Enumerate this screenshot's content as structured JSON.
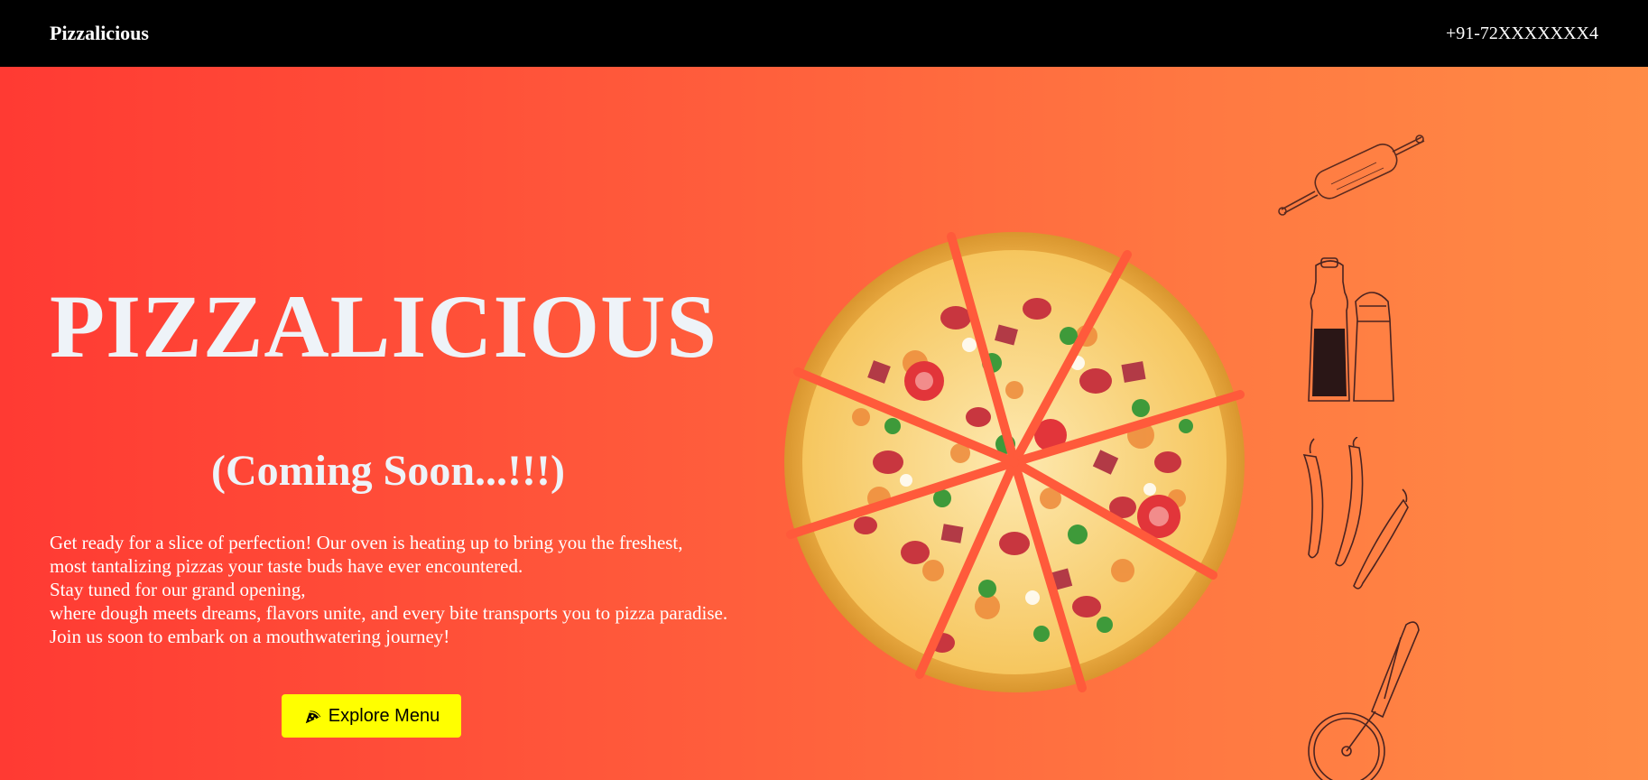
{
  "navbar": {
    "brand": "Pizzalicious",
    "phone": "+91-72XXXXXXX4"
  },
  "hero": {
    "title": "PIZZALICIOUS",
    "subtitle": "(Coming Soon...!!!)",
    "description_lines": [
      "Get ready for a slice of perfection! Our oven is heating up to bring you the freshest,",
      "most tantalizing pizzas your taste buds have ever encountered.",
      "Stay tuned for our grand opening,",
      "where dough meets dreams, flavors unite, and every bite transports you to pizza paradise.",
      "Join us soon to embark on a mouthwatering journey!"
    ],
    "explore_button": {
      "label": "Explore Menu",
      "icon": "pizza-slice-icon"
    }
  },
  "illustrations": {
    "main": "pizza-illustration",
    "decor": [
      "rolling-pin-icon",
      "salt-pepper-shakers-icon",
      "chilli-peppers-icon",
      "pizza-cutter-icon"
    ]
  },
  "colors": {
    "navbar_bg": "#000000",
    "gradient_start": "#ff3a33",
    "gradient_end": "#ff8b45",
    "button_bg": "#ffff00",
    "title_color": "#eef3f8"
  }
}
